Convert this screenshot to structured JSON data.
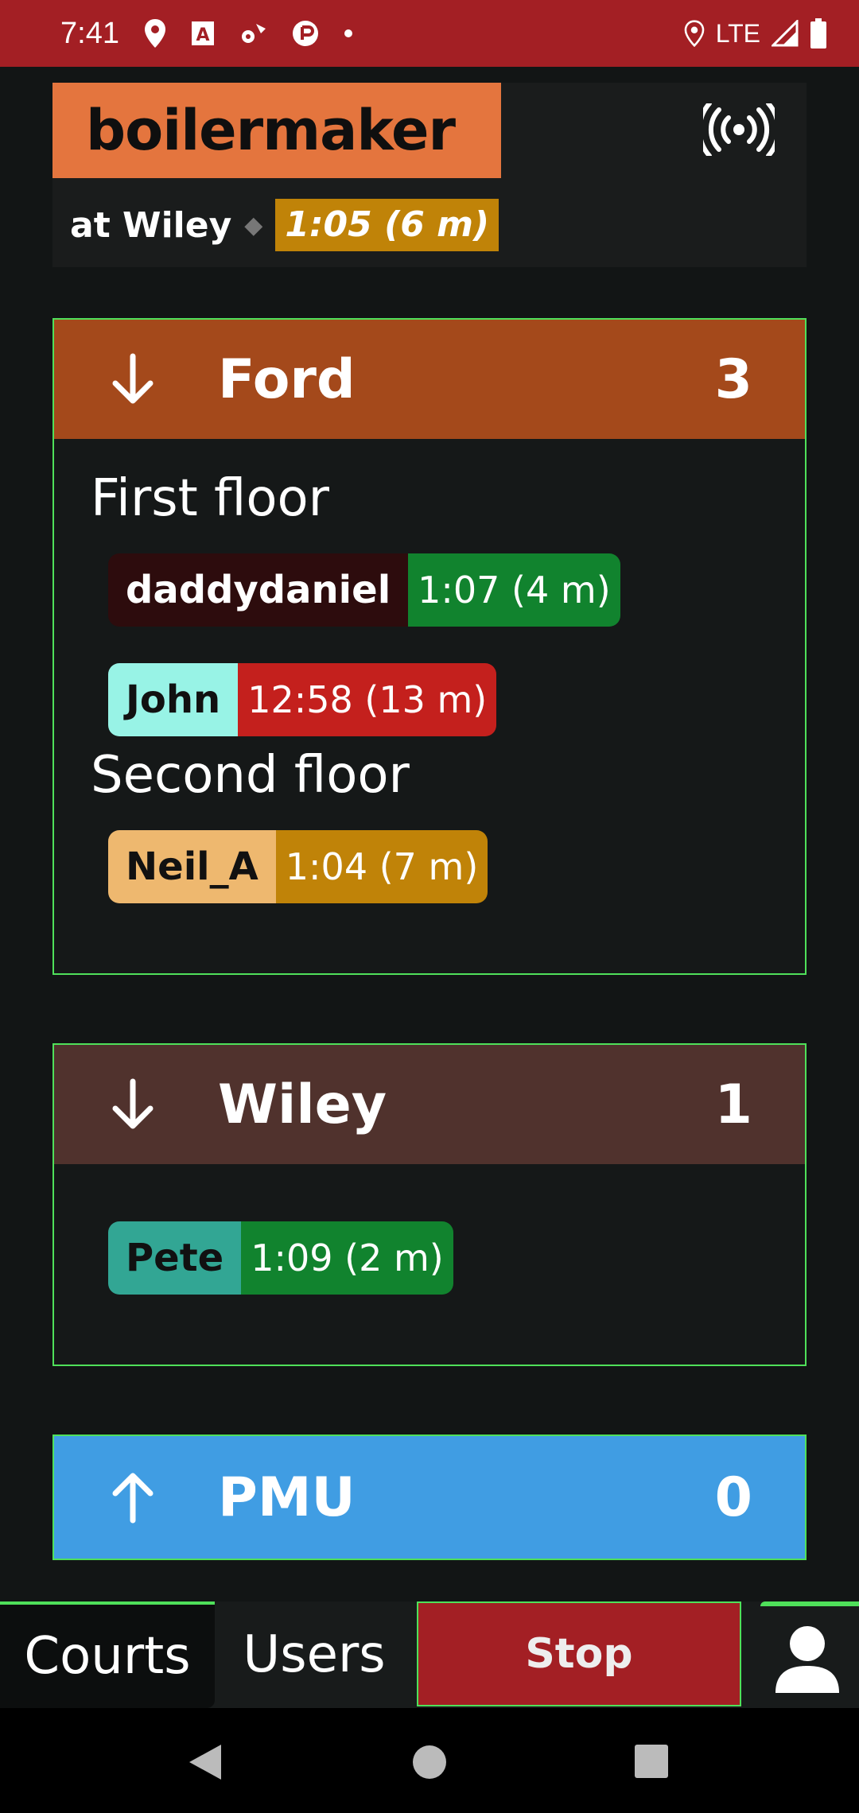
{
  "status_bar": {
    "time": "7:41",
    "network": "LTE",
    "icons": [
      "location-icon",
      "text-a-icon",
      "fan-icon",
      "record-icon",
      "dot-icon",
      "location-icon",
      "signal-icon",
      "battery-icon"
    ]
  },
  "header": {
    "app_title": "boilermaker",
    "location": "at Wiley",
    "separator": "◆",
    "time": "1:05 (6 m)",
    "broadcast_icon": "broadcast-icon"
  },
  "courts": [
    {
      "name": "Ford",
      "count": "3",
      "direction": "down",
      "header_color": "#a4491b",
      "floors": [
        {
          "label": "First floor",
          "users": [
            {
              "name": "daddydaniel",
              "time": "1:07 (4 m)",
              "name_bg": "#2d0c0d",
              "name_color": "#ffffff",
              "time_bg": "#11832e"
            },
            {
              "name": "John",
              "time": "12:58 (13 m)",
              "name_bg": "#98f3e6",
              "name_color": "#111111",
              "time_bg": "#c4201d"
            }
          ]
        },
        {
          "label": "Second floor",
          "users": [
            {
              "name": "Neil_A",
              "time": "1:04 (7 m)",
              "name_bg": "#eeb86f",
              "name_color": "#111111",
              "time_bg": "#c08308"
            }
          ]
        }
      ]
    },
    {
      "name": "Wiley",
      "count": "1",
      "direction": "down",
      "header_color": "#50322d",
      "users": [
        {
          "name": "Pete",
          "time": "1:09 (2 m)",
          "name_bg": "#32a694",
          "name_color": "#111111",
          "time_bg": "#11832e"
        }
      ]
    },
    {
      "name": "PMU",
      "count": "0",
      "direction": "up",
      "header_color": "#409de3"
    }
  ],
  "bottom_nav": {
    "tab_courts": "Courts",
    "tab_users": "Users",
    "stop": "Stop",
    "profile_icon": "person-icon"
  },
  "system_nav": [
    "back-icon",
    "home-icon",
    "recents-icon"
  ]
}
